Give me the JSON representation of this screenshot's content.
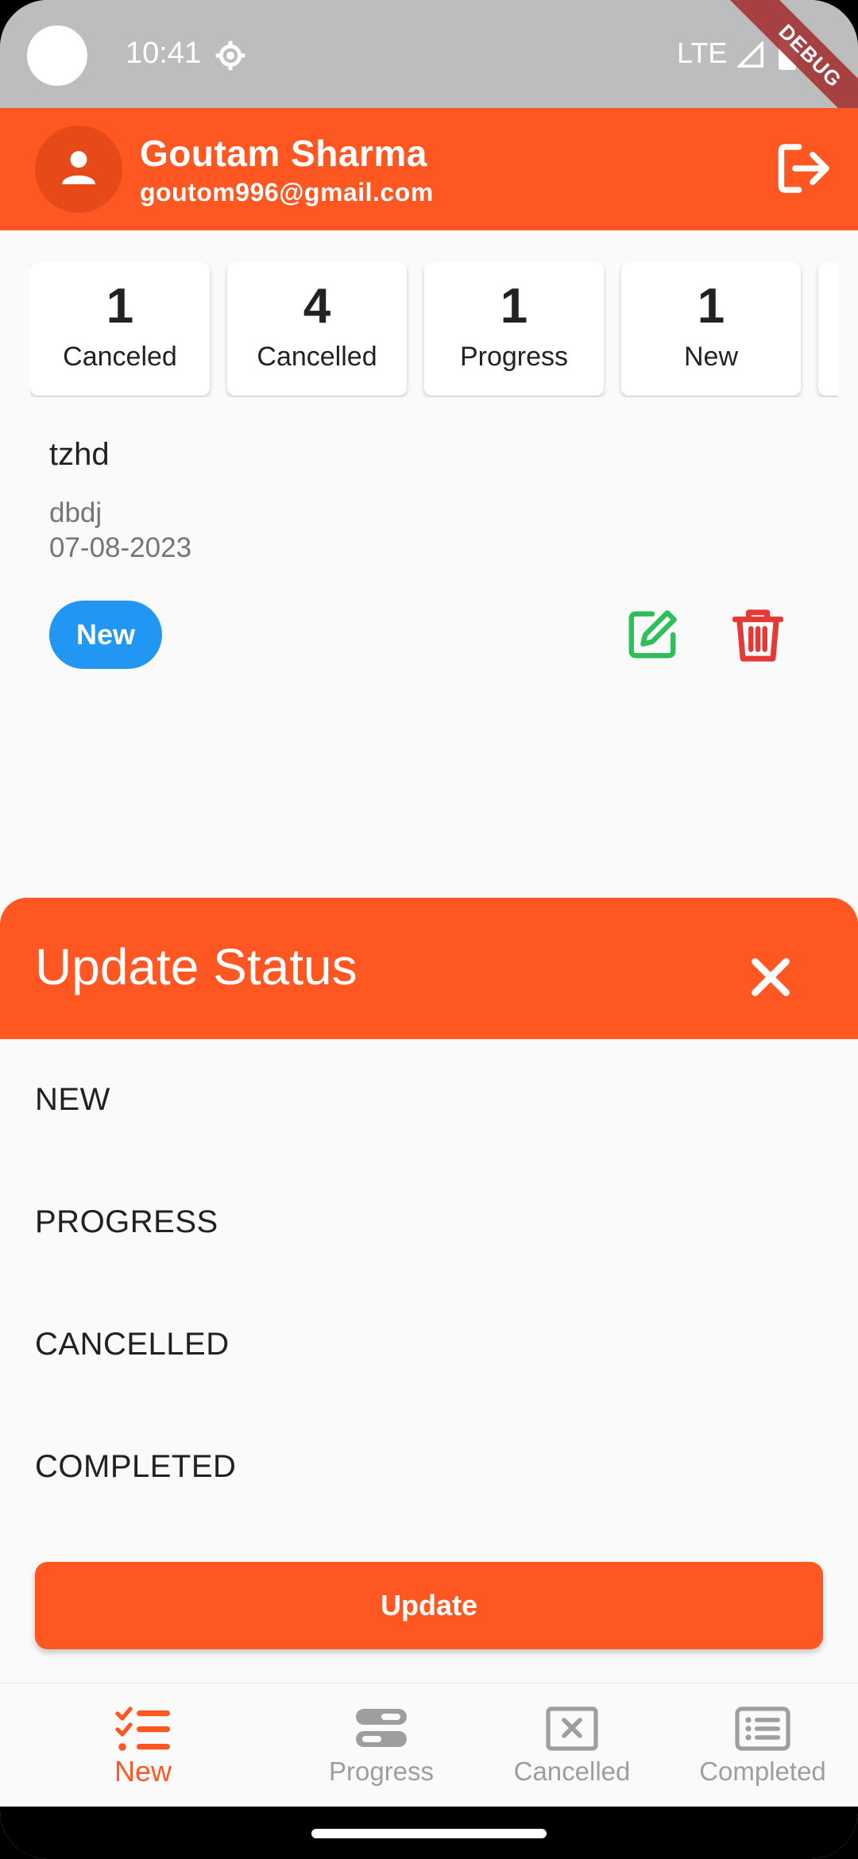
{
  "status_bar": {
    "time": "10:41",
    "network": "LTE",
    "debug_banner": "DEBUG"
  },
  "profile": {
    "name": "Goutam Sharma",
    "email": "goutom996@gmail.com"
  },
  "summary_cards": [
    {
      "count": "1",
      "label": "Canceled"
    },
    {
      "count": "4",
      "label": "Cancelled"
    },
    {
      "count": "1",
      "label": "Progress"
    },
    {
      "count": "1",
      "label": "New"
    }
  ],
  "task": {
    "title": "tzhd",
    "description": "dbdj",
    "date": "07-08-2023",
    "status": "New"
  },
  "update_sheet": {
    "title": "Update Status",
    "options": [
      "NEW",
      "PROGRESS",
      "CANCELLED",
      "COMPLETED"
    ],
    "update_label": "Update"
  },
  "bottom_nav": [
    {
      "label": "New",
      "icon": "checklist-icon",
      "active": true
    },
    {
      "label": "Progress",
      "icon": "progress-icon",
      "active": false
    },
    {
      "label": "Cancelled",
      "icon": "cancelled-icon",
      "active": false
    },
    {
      "label": "Completed",
      "icon": "completed-list-icon",
      "active": false
    }
  ],
  "colors": {
    "primary": "#ff5722",
    "chip_blue": "#2196f3",
    "edit_green": "#2fbf5a",
    "delete_red": "#e53935"
  }
}
